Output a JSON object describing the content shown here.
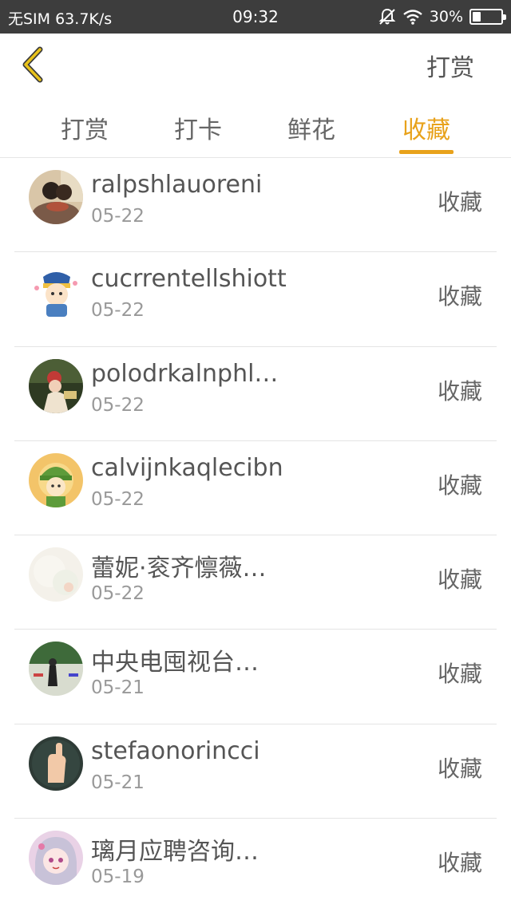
{
  "status_bar": {
    "carrier": "无SIM 63.7K/s",
    "time": "09:32",
    "battery": "30%",
    "battery_level": 0.3
  },
  "header": {
    "back_icon": "chevron-left-icon",
    "action_label": "打赏",
    "accent_color": "#e8a21b"
  },
  "tabs": [
    {
      "label": "打赏",
      "active": false
    },
    {
      "label": "打卡",
      "active": false
    },
    {
      "label": "鲜花",
      "active": false
    },
    {
      "label": "收藏",
      "active": true
    }
  ],
  "list": [
    {
      "name": "ralpshlauoreni",
      "date": "05-22",
      "action": "收藏"
    },
    {
      "name": "cucrrentellshiott",
      "date": "05-22",
      "action": "收藏"
    },
    {
      "name": "polodrkalnphl…",
      "date": "05-22",
      "action": "收藏"
    },
    {
      "name": "calvijnkaqlecibn",
      "date": "05-22",
      "action": "收藏"
    },
    {
      "name": "蕾妮·衮齐懔薇…",
      "date": "05-22",
      "action": "收藏"
    },
    {
      "name": "中央电囤视台…",
      "date": "05-21",
      "action": "收藏"
    },
    {
      "name": "stefaonorincci",
      "date": "05-21",
      "action": "收藏"
    },
    {
      "name": "璃月应聘咨询…",
      "date": "05-19",
      "action": "收藏"
    }
  ]
}
